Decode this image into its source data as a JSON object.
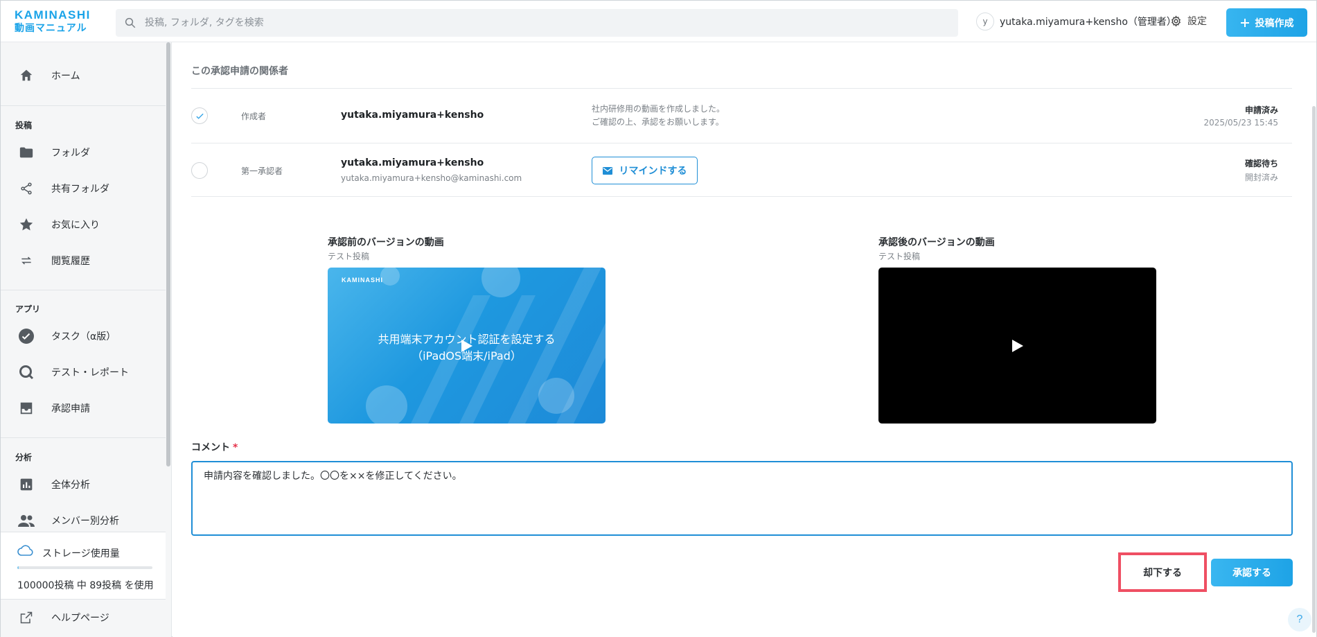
{
  "logo": {
    "brand": "KAMINASHI",
    "product": "動画マニュアル"
  },
  "search": {
    "placeholder": "投稿, フォルダ, タグを検索"
  },
  "user": {
    "initial": "y",
    "name": "yutaka.miyamura+kensho（管理者）"
  },
  "settings_label": "設定",
  "create_label": "投稿作成",
  "sidebar": {
    "home": "ホーム",
    "section_posts": "投稿",
    "folder": "フォルダ",
    "shared_folder": "共有フォルダ",
    "favorites": "お気に入り",
    "history": "閲覧履歴",
    "section_apps": "アプリ",
    "task": "タスク（α版）",
    "test_report": "テスト・レポート",
    "approval": "承認申請",
    "section_analysis": "分析",
    "overall_analysis": "全体分析",
    "member_analysis": "メンバー別分析",
    "storage_title": "ストレージ使用量",
    "storage_text": "100000投稿 中 89投稿 を使用",
    "storage_used_fraction": 0.00089,
    "help": "ヘルプページ"
  },
  "main": {
    "section_title": "この承認申請の関係者",
    "rows": [
      {
        "role": "作成者",
        "name": "yutaka.miyamura+kensho",
        "message_line1": "社内研修用の動画を作成しました。",
        "message_line2": "ご確認の上、承認をお願いします。",
        "status": "申請済み",
        "status_sub": "2025/05/23 15:45",
        "checked": true
      },
      {
        "role": "第一承認者",
        "name": "yutaka.miyamura+kensho",
        "email": "yutaka.miyamura+kensho@kaminashi.com",
        "remind_label": "リマインドする",
        "status": "確認待ち",
        "status_sub": "開封済み",
        "checked": false
      }
    ],
    "before": {
      "title": "承認前のバージョンの動画",
      "subtitle": "テスト投稿",
      "thumb_brand": "KAMINASHI",
      "thumb_line1": "共用端末アカウント認証を設定する",
      "thumb_line2": "（iPadOS端末/iPad）"
    },
    "after": {
      "title": "承認後のバージョンの動画",
      "subtitle": "テスト投稿"
    },
    "comment_label": "コメント",
    "comment_required": "*",
    "comment_value": "申請内容を確認しました。〇〇を××を修正してください。",
    "reject_label": "却下する",
    "approve_label": "承認する",
    "help_label": "?"
  },
  "colors": {
    "accent": "#1ea3e6",
    "highlight": "#ef4f63",
    "border": "#1f8ed6"
  }
}
